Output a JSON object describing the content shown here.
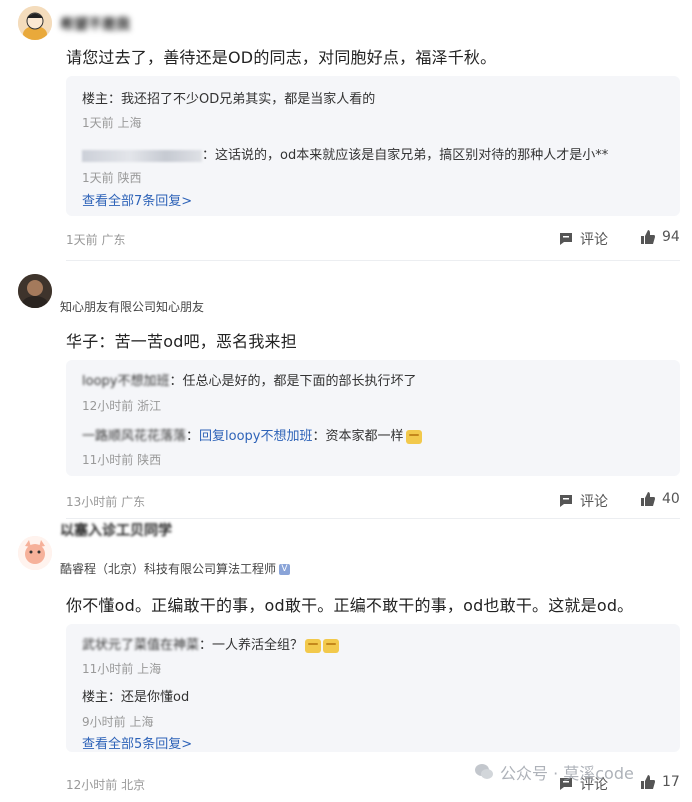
{
  "comments": [
    {
      "username": "希望不是我",
      "company": "",
      "text": "请您过去了，善待还是OD的同志，对同胞好点，福泽千秋。",
      "replies": [
        {
          "author": "楼主",
          "sep": "：",
          "text": "我还招了不少OD兄弟其实，都是当家人看的",
          "meta": "1天前 上海"
        },
        {
          "author": "",
          "sep": "：",
          "text": "这话说的，od本来就应该是自家兄弟，搞区别对待的那种人才是小**",
          "meta": "1天前 陕西"
        }
      ],
      "view_all": "查看全部7条回复>",
      "meta": "1天前 广东",
      "comment_label": "评论",
      "likes": "94"
    },
    {
      "username": "",
      "company": "知心朋友有限公司知心朋友",
      "text": "华子：苦一苦od吧，恶名我来担",
      "replies": [
        {
          "author": "loopy不想加班",
          "sep": "：",
          "text": "任总心是好的，都是下面的部长执行坏了",
          "meta": "12小时前 浙江"
        },
        {
          "author": "一路顺风花花落落",
          "sep": "：",
          "at": "回复loopy不想加班",
          "text": "：资本家都一样",
          "meta": "11小时前 陕西"
        }
      ],
      "meta": "13小时前 广东",
      "comment_label": "评论",
      "likes": "40"
    },
    {
      "username": "以塞入诊工贝同学",
      "company": "酷睿程（北京）科技有限公司算法工程师",
      "text": "你不懂od。正编敢干的事，od敢干。正编不敢干的事，od也敢干。这就是od。",
      "replies": [
        {
          "author": "武状元了菜值在神菜",
          "sep": "：",
          "text": "一人养活全组？",
          "meta": "11小时前 上海"
        },
        {
          "author": "楼主",
          "sep": "：",
          "text": "还是你懂od",
          "meta": "9小时前 上海"
        }
      ],
      "view_all": "查看全部5条回复>",
      "meta": "12小时前 北京",
      "comment_label": "评论",
      "likes": "17"
    }
  ],
  "watermark": "公众号 · 莫溪code",
  "colors": {
    "link": "#2e63b8",
    "reply_bg": "#f5f6f9",
    "meta": "#999999"
  }
}
